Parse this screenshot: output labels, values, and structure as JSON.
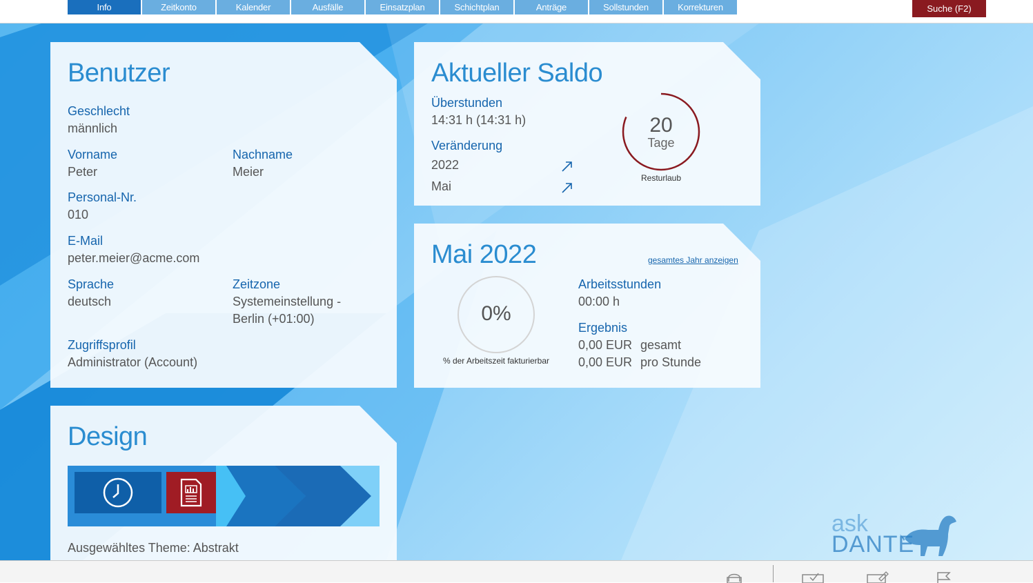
{
  "nav": {
    "tabs": [
      "Info",
      "Zeitkonto",
      "Kalender",
      "Ausfälle",
      "Einsatzplan",
      "Schichtplan",
      "Anträge",
      "Sollstunden",
      "Korrekturen"
    ],
    "search_label": "Suche (F2)"
  },
  "user": {
    "title": "Benutzer",
    "gender_label": "Geschlecht",
    "gender": "männlich",
    "firstname_label": "Vorname",
    "firstname": "Peter",
    "lastname_label": "Nachname",
    "lastname": "Meier",
    "personal_label": "Personal-Nr.",
    "personal": "010",
    "email_label": "E-Mail",
    "email": "peter.meier@acme.com",
    "lang_label": "Sprache",
    "lang": "deutsch",
    "tz_label": "Zeitzone",
    "tz_line1": "Systemeinstellung -",
    "tz_line2": "Berlin (+01:00)",
    "profile_label": "Zugriffsprofil",
    "profile": "Administrator (Account)"
  },
  "saldo": {
    "title": "Aktueller Saldo",
    "overtime_label": "Überstunden",
    "overtime": "14:31 h (14:31 h)",
    "change_label": "Veränderung",
    "change_rows": [
      {
        "label": "2022"
      },
      {
        "label": "Mai"
      }
    ],
    "vacation_days": "20",
    "vacation_unit": "Tage",
    "vacation_caption": "Resturlaub"
  },
  "month": {
    "title": "Mai 2022",
    "link": "gesamtes Jahr anzeigen",
    "percent": "0%",
    "percent_caption": "% der Arbeitszeit fakturierbar",
    "hours_label": "Arbeitsstunden",
    "hours": "00:00 h",
    "result_label": "Ergebnis",
    "result_total_value": "0,00 EUR",
    "result_total_unit": "gesamt",
    "result_hour_value": "0,00 EUR",
    "result_hour_unit": "pro Stunde"
  },
  "design": {
    "title": "Design",
    "theme_text": "Ausgewähltes Theme: Abstrakt"
  },
  "logo": {
    "line1": "ask",
    "line2": "DANTE"
  },
  "colors": {
    "accent": "#1665ad",
    "tab": "#6aaee0",
    "tab_active": "#1a6fbd",
    "danger": "#8a1a20"
  }
}
